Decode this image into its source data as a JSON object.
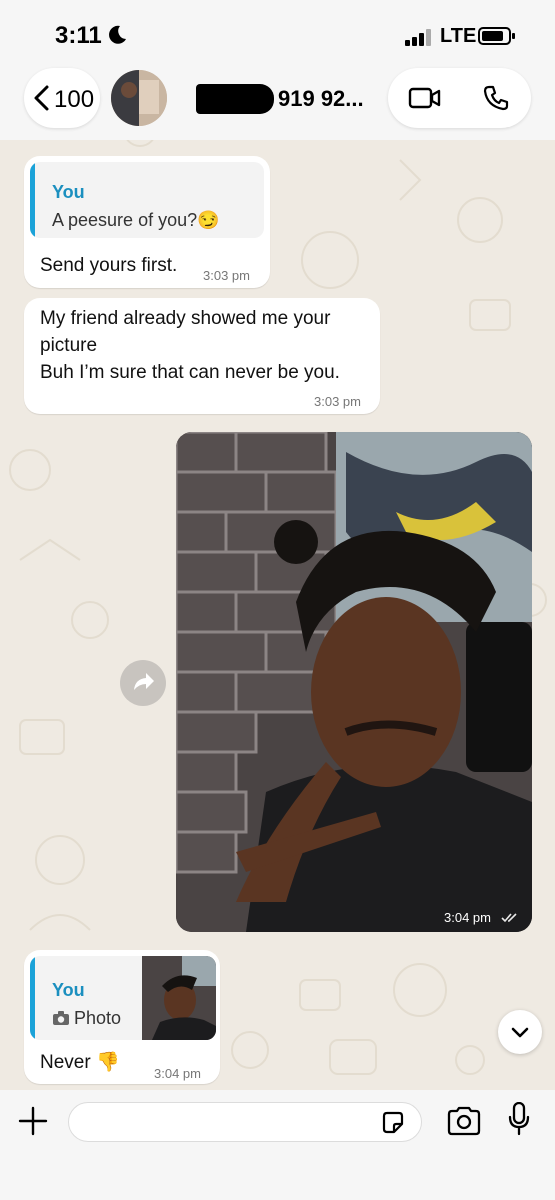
{
  "status_bar": {
    "time": "3:11",
    "network": "LTE"
  },
  "header": {
    "back_count": "100",
    "contact_phone": "919 92..."
  },
  "messages": [
    {
      "quote_author": "You",
      "quote_text": "A peesure of you?😏",
      "text": "Send yours first.",
      "time": "3:03 pm"
    },
    {
      "text_line1": "My friend already showed me your",
      "text_line2": "picture",
      "text_line3": "Buh I’m sure that can never be you.",
      "time": "3:03 pm"
    },
    {
      "type": "photo",
      "time": "3:04 pm",
      "status": "read"
    },
    {
      "quote_author": "You",
      "quote_text": "Photo",
      "text": "Never 👎",
      "time": "3:04 pm"
    }
  ],
  "colors": {
    "quote_bar": "#1ba2d8",
    "quote_name": "#1b8fbf",
    "chat_bg": "#efeae2"
  }
}
